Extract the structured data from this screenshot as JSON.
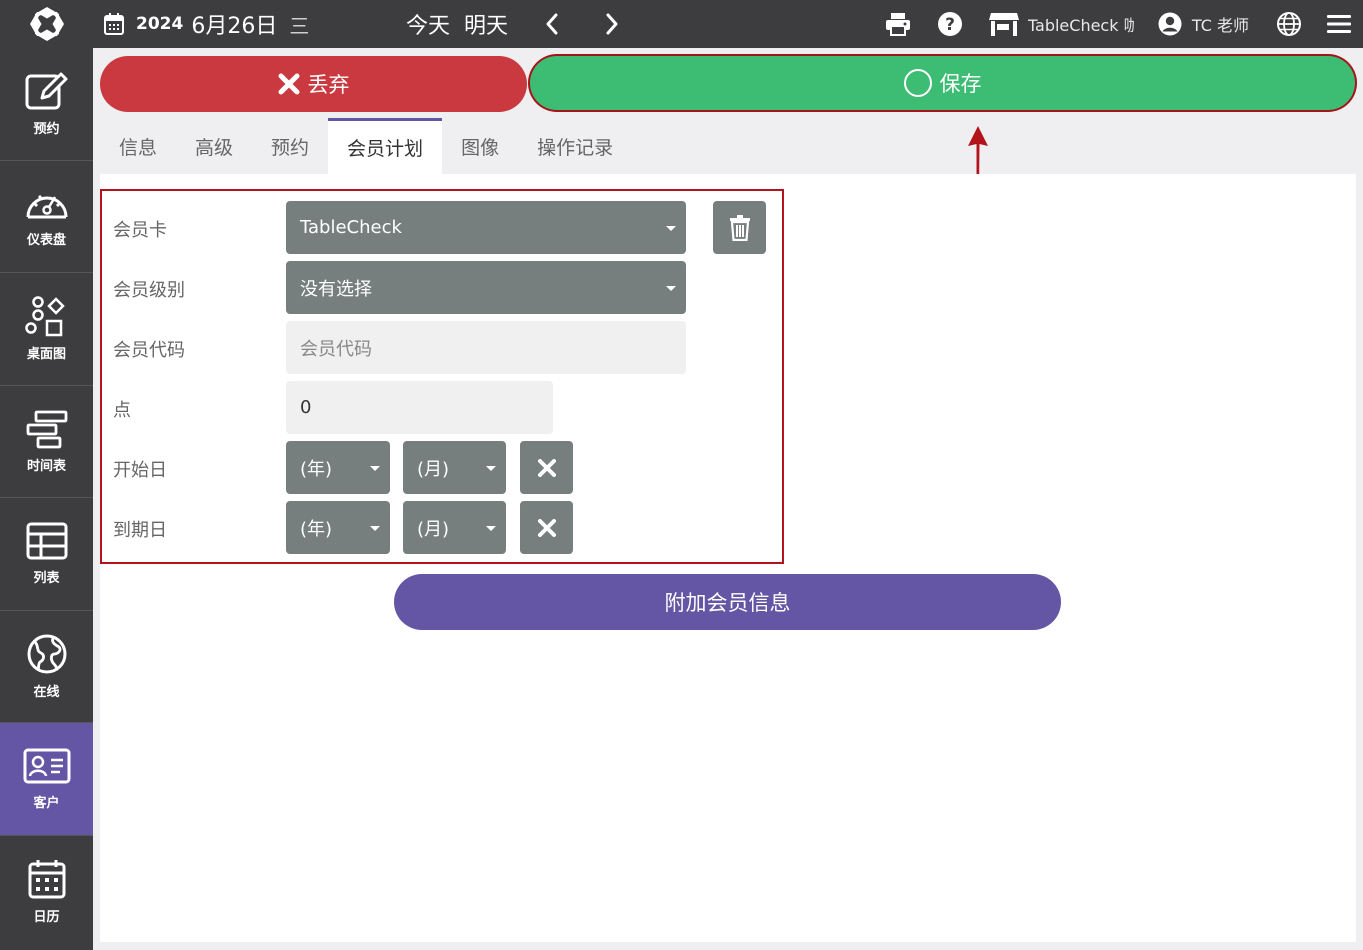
{
  "topbar": {
    "year": "2024",
    "month_day": "6月26日",
    "weekday": "三",
    "today": "今天",
    "tomorrow": "明天",
    "shop_label": "TableCheck 咖啡",
    "user_label": "TC 老师"
  },
  "sidebar": {
    "items": [
      {
        "label": "预约",
        "icon": "edit-icon"
      },
      {
        "label": "仪表盘",
        "icon": "dashboard-icon"
      },
      {
        "label": "桌面图",
        "icon": "shapes-icon"
      },
      {
        "label": "时间表",
        "icon": "timeline-icon"
      },
      {
        "label": "列表",
        "icon": "table-icon"
      },
      {
        "label": "在线",
        "icon": "globe-icon"
      },
      {
        "label": "客户",
        "icon": "id-card-icon"
      },
      {
        "label": "日历",
        "icon": "calendar-icon"
      }
    ],
    "active_index": 6
  },
  "actions": {
    "discard_label": "丢弃",
    "save_label": "保存"
  },
  "tabs": [
    "信息",
    "高级",
    "预约",
    "会员计划",
    "图像",
    "操作记录"
  ],
  "active_tab": "会员计划",
  "form": {
    "card_label": "会员卡",
    "card_value": "TableCheck",
    "level_label": "会员级别",
    "level_value": "没有选择",
    "code_label": "会员代码",
    "code_placeholder": "会员代码",
    "points_label": "点",
    "points_value": "0",
    "start_label": "开始日",
    "start_year": "(年)",
    "start_month": "(月)",
    "end_label": "到期日",
    "end_year": "(年)",
    "end_month": "(月)"
  },
  "add_membership_label": "附加会员信息",
  "colors": {
    "sidebar_bg": "#3d3d3f",
    "accent_purple": "#6456a5",
    "discard_red": "#c9393f",
    "save_green": "#3dbc74",
    "annotation_red": "#b3141c"
  }
}
